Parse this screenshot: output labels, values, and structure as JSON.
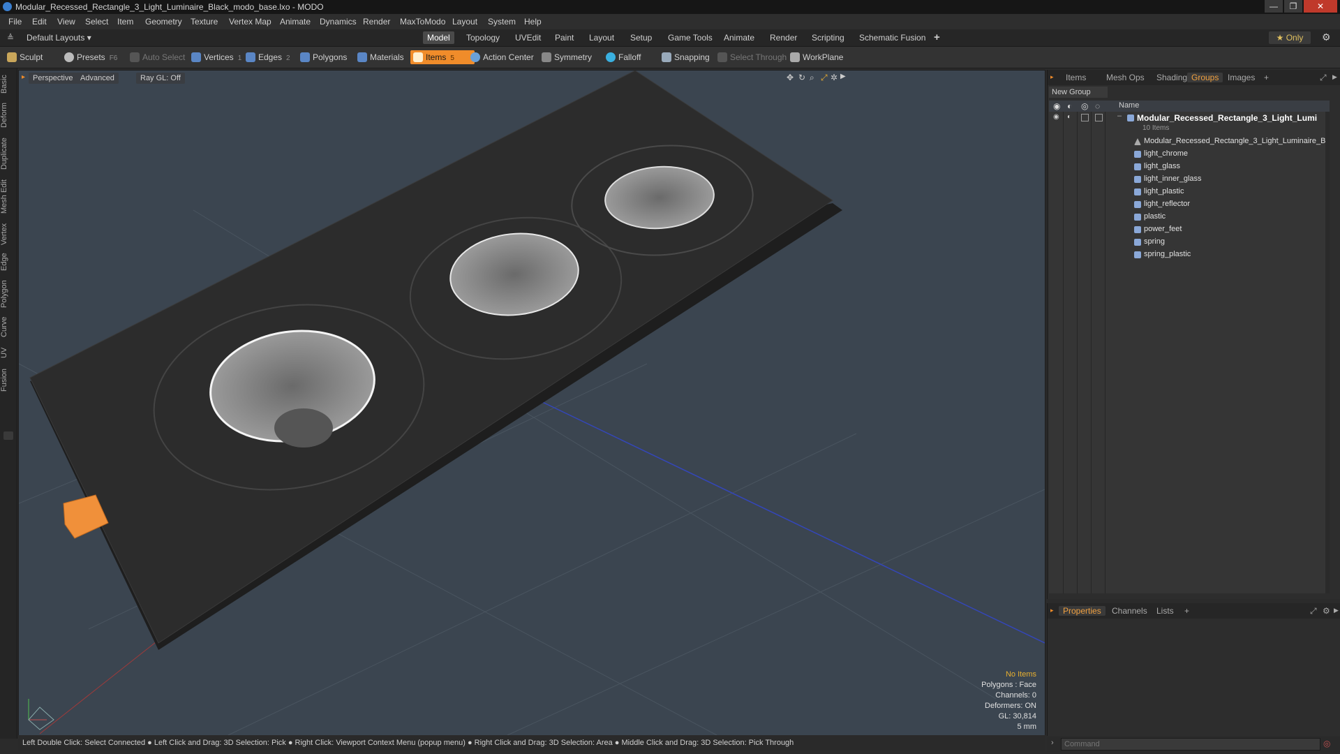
{
  "window": {
    "title": "Modular_Recessed_Rectangle_3_Light_Luminaire_Black_modo_base.lxo - MODO",
    "minimize": "—",
    "maximize": "❐",
    "close": "✕"
  },
  "menu": [
    "File",
    "Edit",
    "View",
    "Select",
    "Item",
    "Geometry",
    "Texture",
    "Vertex Map",
    "Animate",
    "Dynamics",
    "Render",
    "MaxToModo",
    "Layout",
    "System",
    "Help"
  ],
  "layouts": {
    "selector": "Default Layouts ▾"
  },
  "layout_tabs": [
    "Model",
    "Topology",
    "UVEdit",
    "Paint",
    "Layout",
    "Setup",
    "Game Tools",
    "Animate",
    "Render",
    "Scripting",
    "Schematic Fusion"
  ],
  "layout_tabs_add": "+",
  "only_label": "★ Only",
  "toolbar": {
    "sculpt": "Sculpt",
    "presets": "Presets",
    "presets_key": "F6",
    "auto_select": "Auto Select",
    "vertices": "Vertices",
    "vertices_count": "1",
    "edges": "Edges",
    "edges_count": "2",
    "polygons": "Polygons",
    "materials": "Materials",
    "items": "Items",
    "items_count": "5",
    "action_center": "Action Center",
    "symmetry": "Symmetry",
    "falloff": "Falloff",
    "snapping": "Snapping",
    "select_through": "Select Through",
    "workplane": "WorkPlane"
  },
  "left_tabs": [
    "Basic",
    "Deform",
    "Duplicate",
    "Mesh Edit",
    "Vertex",
    "Edge",
    "Polygon",
    "Curve",
    "UV",
    "Fusion"
  ],
  "viewport": {
    "perspective": "Perspective",
    "advanced": "Advanced",
    "raygl": "Ray GL: Off",
    "info": {
      "no_items": "No Items",
      "polygons": "Polygons : Face",
      "channels": "Channels: 0",
      "deformers": "Deformers: ON",
      "gl": "GL: 30,814",
      "scale": "5 mm"
    }
  },
  "statusbar": "Left Double Click: Select Connected ● Left Click and Drag: 3D Selection: Pick ● Right Click: Viewport Context Menu (popup menu) ● Right Click and Drag: 3D Selection: Area ● Middle Click and Drag: 3D Selection: Pick Through",
  "right_tabs": [
    "Items",
    "Mesh Ops",
    "Shading",
    "Groups",
    "Images",
    "+"
  ],
  "groups": {
    "new_group": "New Group",
    "col_name": "Name",
    "group_name": "Modular_Recessed_Rectangle_3_Light_Lumi ...",
    "group_count": "10 Items",
    "items": [
      "Modular_Recessed_Rectangle_3_Light_Luminaire_B...",
      "light_chrome",
      "light_glass",
      "light_inner_glass",
      "light_plastic",
      "light_reflector",
      "plastic",
      "power_feet",
      "spring",
      "spring_plastic"
    ]
  },
  "prop_tabs": [
    "Properties",
    "Channels",
    "Lists",
    "+"
  ],
  "command": {
    "placeholder": "Command"
  },
  "colors": {
    "accent": "#f08c2a",
    "tab_active": "#f0a040",
    "viewport_bg": "#3c4650"
  }
}
